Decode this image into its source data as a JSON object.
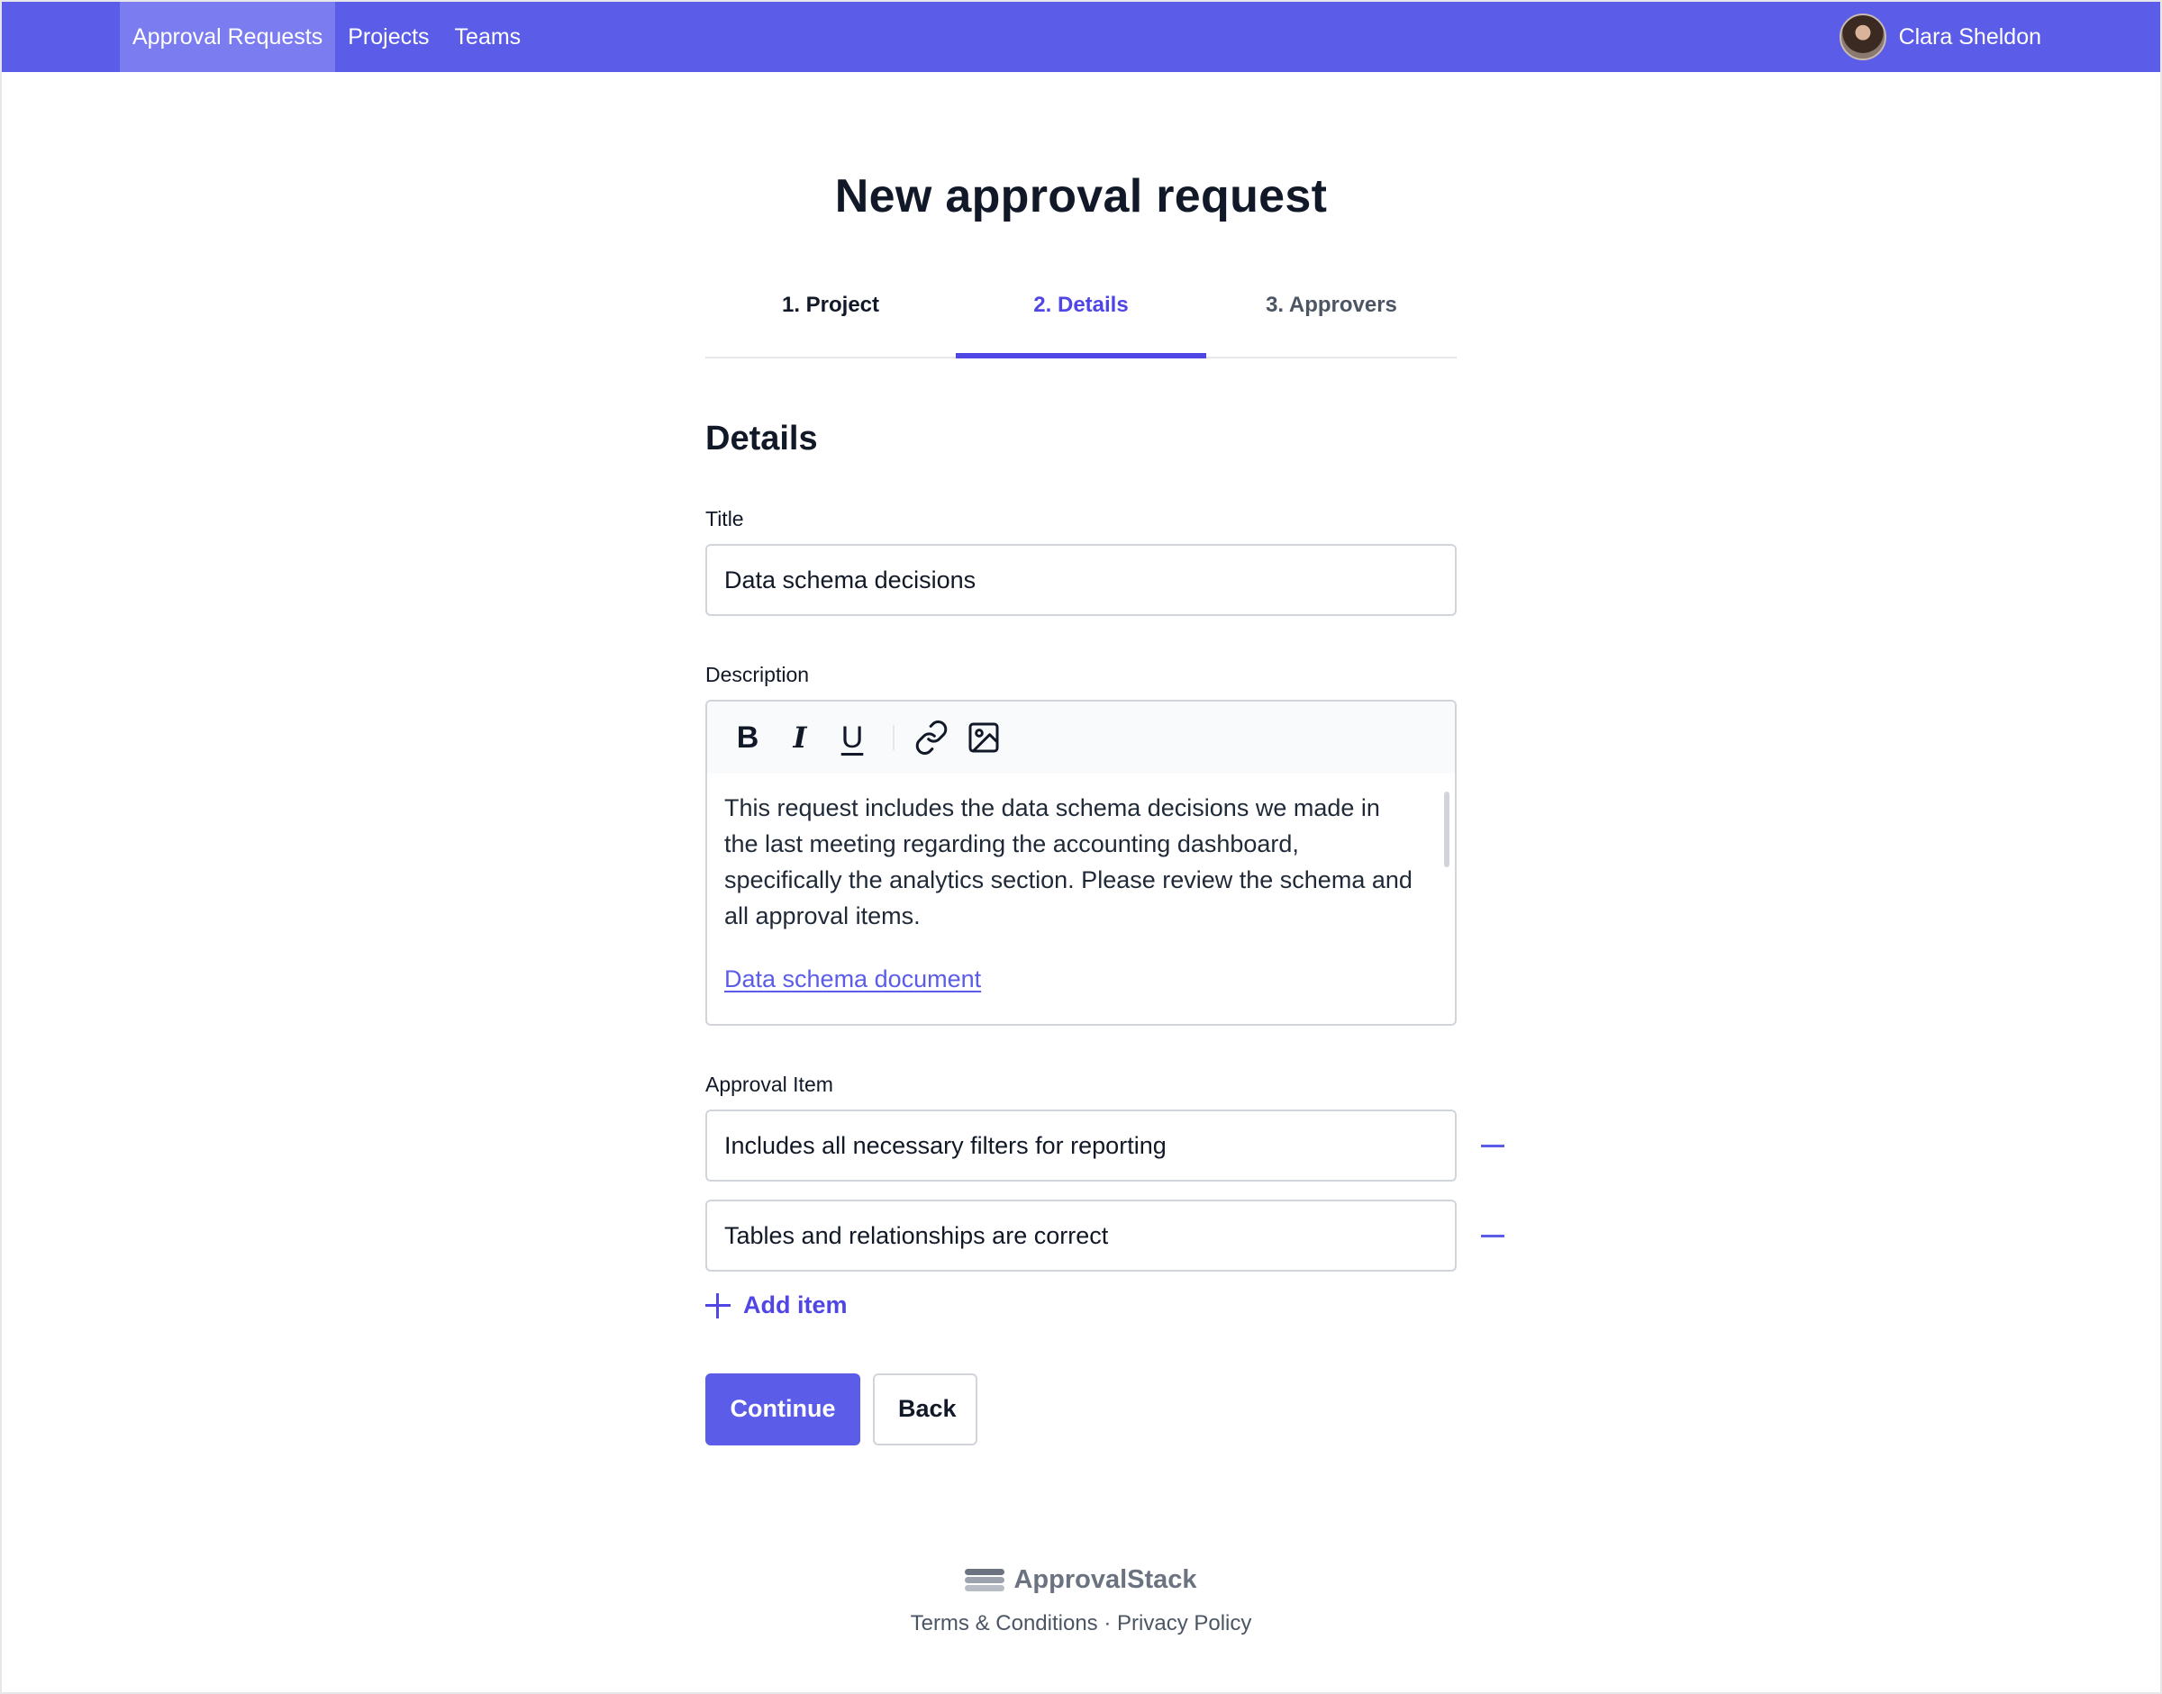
{
  "nav": {
    "items": [
      {
        "label": "Approval Requests",
        "active": true
      },
      {
        "label": "Projects"
      },
      {
        "label": "Teams"
      }
    ],
    "user_name": "Clara Sheldon"
  },
  "page": {
    "title": "New approval request",
    "steps": [
      {
        "label": "1. Project",
        "state": "done"
      },
      {
        "label": "2. Details",
        "state": "active"
      },
      {
        "label": "3. Approvers",
        "state": "upcoming"
      }
    ],
    "section_title": "Details"
  },
  "form": {
    "title_label": "Title",
    "title_value": "Data schema decisions",
    "description_label": "Description",
    "toolbar": {
      "bold": "B",
      "italic": "I",
      "underline": "U"
    },
    "description_text": "This request includes the data schema decisions we made in the last meeting regarding the accounting dashboard, specifically the analytics section. Please review the schema and all approval items.",
    "description_link": "Data schema document",
    "approval_item_label": "Approval Item",
    "approval_items": [
      "Includes all necessary filters for reporting",
      "Tables and relationships are correct"
    ],
    "add_item_label": "Add item",
    "continue_label": "Continue",
    "back_label": "Back"
  },
  "footer": {
    "brand": "ApprovalStack",
    "terms": "Terms & Conditions",
    "separator": "·",
    "privacy": "Privacy Policy"
  },
  "colors": {
    "primary": "#5b5ce8",
    "nav_active": "#7b7cf0",
    "text": "#111827"
  }
}
